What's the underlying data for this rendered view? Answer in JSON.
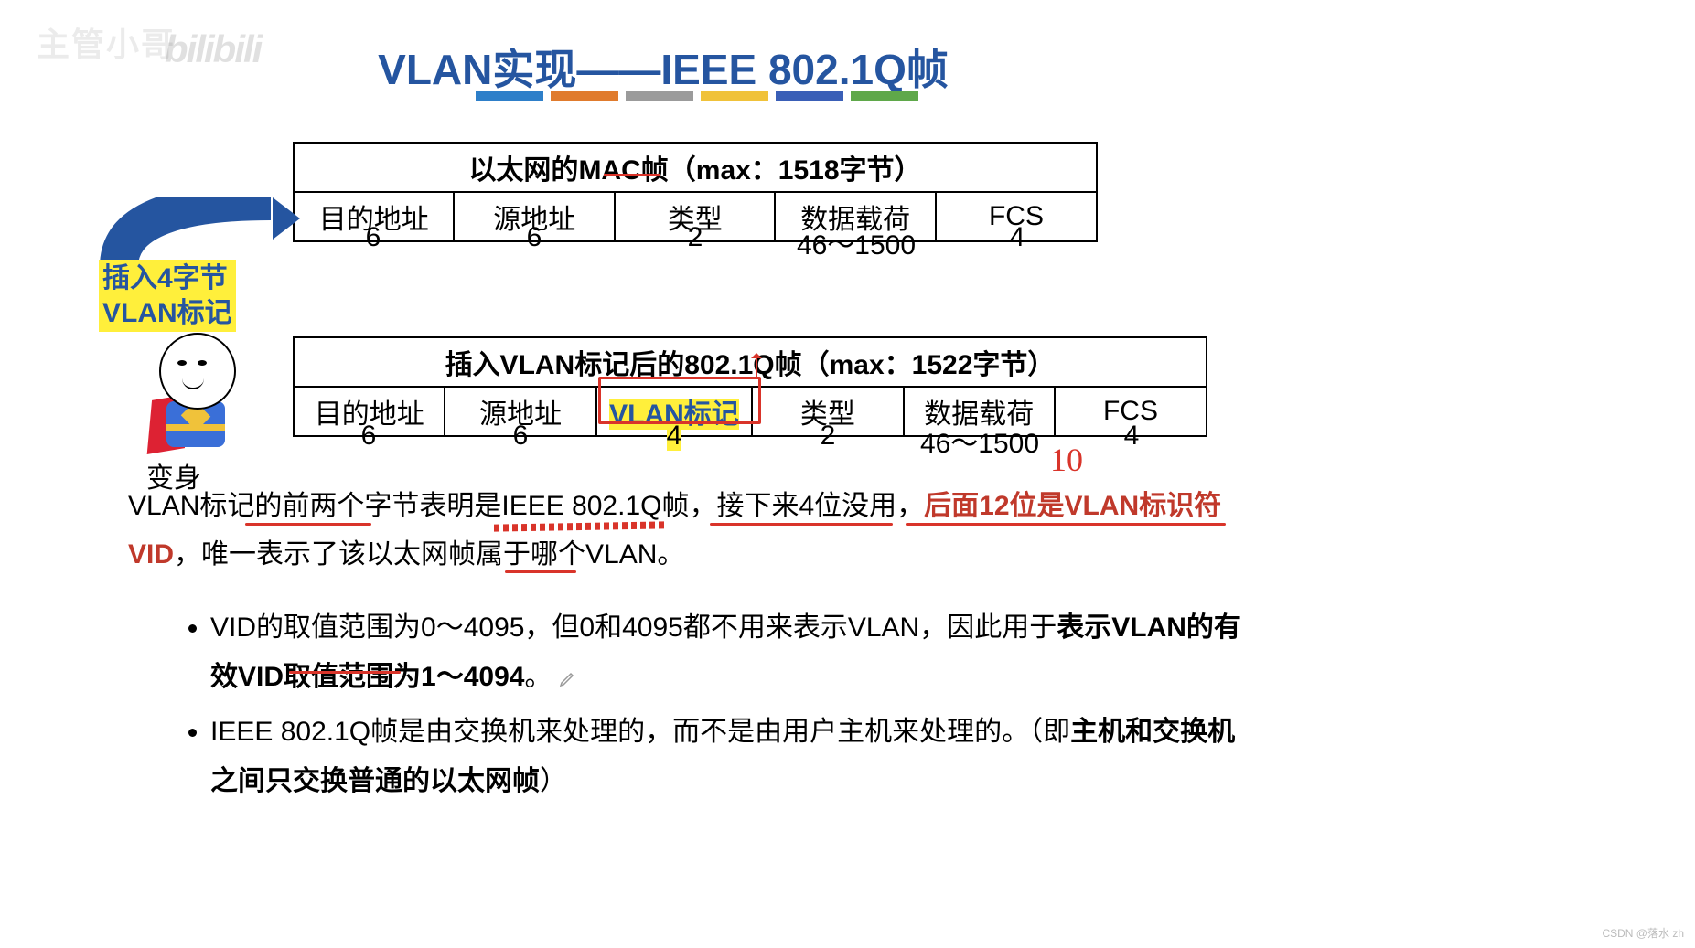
{
  "watermark_tl": "主管小哥",
  "bili": "bilibili",
  "title": "VLAN实现——IEEE 802.1Q帧",
  "table1": {
    "caption_pre": "以太网的",
    "caption_mac": "MAC",
    "caption_post": "帧（max：1518字节）",
    "cols": [
      "目的地址",
      "源地址",
      "类型",
      "数据载荷",
      "FCS"
    ],
    "sizes": [
      "6",
      "6",
      "2",
      "46～1500",
      "4"
    ]
  },
  "note_box_l1": "插入4字节",
  "note_box_l2": "VLAN标记",
  "avatar_label": "变身",
  "table2": {
    "caption": "插入VLAN标记后的802.1Q帧（max：1522字节）",
    "cols": [
      "目的地址",
      "源地址",
      "VLAN标记",
      "类型",
      "数据载荷",
      "FCS"
    ],
    "sizes": [
      "6",
      "6",
      "4",
      "2",
      "46～1500",
      "4"
    ]
  },
  "anno_10": "10",
  "para1_a": "VLAN标记的前两个字节表明是IEEE 802.1Q帧，接下来4位没用，",
  "para1_red": "后面12位是VLAN标识符VID",
  "para1_b": "，唯一表示了该以太网帧属于哪个VLAN。",
  "bullet1_a": "VID的取值范围为0～4095，但0和4095都不用来表示VLAN，因此用于",
  "bullet1_b": "表示VLAN的有效VID取值范围为1～4094",
  "bullet1_c": "。",
  "bullet2_a": "IEEE 802.1Q帧是由交换机来处理的，而不是由用户主机来处理的。（即",
  "bullet2_b": "主机和交换机之间只交换普通的以太网帧",
  "bullet2_c": "）",
  "csdn": "CSDN @落水 zh",
  "chart_data": {
    "type": "table",
    "title": "IEEE 802.1Q frame structure (bytes)",
    "series": [
      {
        "name": "以太网的MAC帧 (max 1518)",
        "fields": [
          "目的地址",
          "源地址",
          "类型",
          "数据载荷",
          "FCS"
        ],
        "bytes": [
          6,
          6,
          2,
          "46~1500",
          4
        ]
      },
      {
        "name": "插入VLAN标记后的802.1Q帧 (max 1522)",
        "fields": [
          "目的地址",
          "源地址",
          "VLAN标记",
          "类型",
          "数据载荷",
          "FCS"
        ],
        "bytes": [
          6,
          6,
          4,
          2,
          "46~1500",
          4
        ]
      }
    ],
    "vid_range_total": "0~4095",
    "vid_range_valid": "1~4094",
    "vlan_tag_structure": {
      "tpid_bytes": 2,
      "unused_bits": 4,
      "vid_bits": 12
    }
  }
}
